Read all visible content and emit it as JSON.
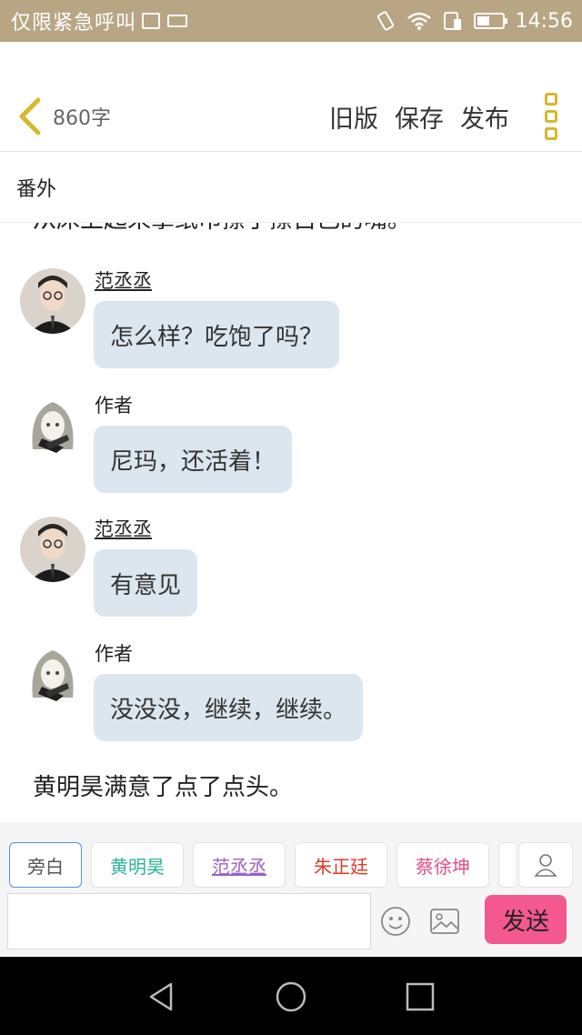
{
  "status_bar": {
    "carrier_text": "仅限紧急呼叫",
    "time": "14:56",
    "battery_level": 0.5,
    "icons": [
      "image-icon",
      "keyboard-icon",
      "vibrate-icon",
      "wifi-icon",
      "sim-icon",
      "battery-icon"
    ]
  },
  "header": {
    "word_count": "860字",
    "actions": {
      "old_version": "旧版",
      "save": "保存",
      "publish": "发布"
    },
    "accent_color": "#d4b92d"
  },
  "chapter": {
    "title": "番外"
  },
  "content": {
    "cut_off_line": "从床上起来拿纸巾擦了擦自己的嘴。",
    "messages": [
      {
        "speaker": "范丞丞",
        "text": "怎么样？吃饱了吗？",
        "avatar": "photo-avatar"
      },
      {
        "speaker": "作者",
        "text": "尼玛，还活着！",
        "avatar": "anime-avatar"
      },
      {
        "speaker": "范丞丞",
        "text": "有意见",
        "avatar": "photo-avatar"
      },
      {
        "speaker": "作者",
        "text": "没没没，继续，继续。",
        "avatar": "anime-avatar"
      }
    ],
    "narration": "黄明昊满意了点了点头。",
    "bubble_color": "#dce6ee"
  },
  "composer": {
    "roles": [
      {
        "label": "旁白",
        "color": "#555555",
        "active": true
      },
      {
        "label": "黄明昊",
        "color": "#2bb59a",
        "active": false
      },
      {
        "label": "范丞丞",
        "color": "#9c5fc9",
        "active": false
      },
      {
        "label": "朱正廷",
        "color": "#e0382c",
        "active": false
      },
      {
        "label": "蔡徐坤",
        "color": "#e0508a",
        "active": false
      }
    ],
    "input_value": "",
    "send_label": "发送",
    "send_color": "#f3588f"
  }
}
